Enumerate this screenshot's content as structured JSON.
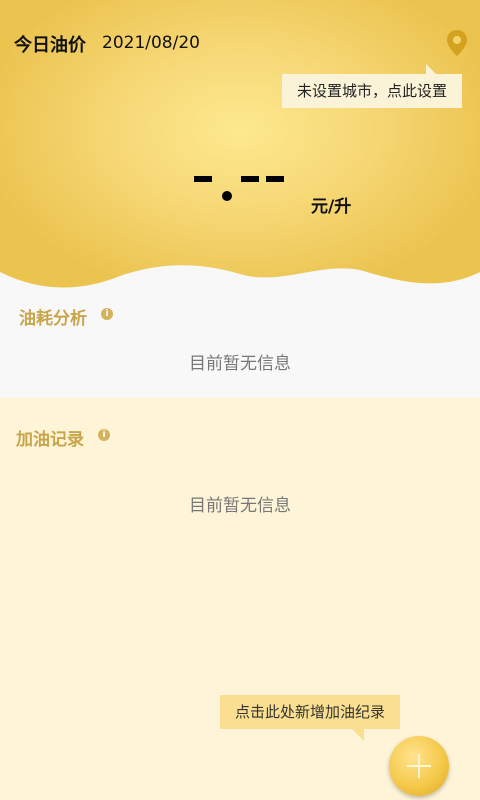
{
  "header": {
    "title": "今日油价",
    "date": "2021/08/20",
    "city_tip": "未设置城市，点此设置"
  },
  "price": {
    "unit": "元/升"
  },
  "consumption": {
    "title": "油耗分析",
    "empty_text": "目前暂无信息"
  },
  "records": {
    "title": "加油记录",
    "empty_text": "目前暂无信息"
  },
  "add_tip": "点击此处新增加油纪录",
  "colors": {
    "gold": "#ebc450",
    "section_title": "#c7a54a",
    "background": "#fef6d9"
  }
}
